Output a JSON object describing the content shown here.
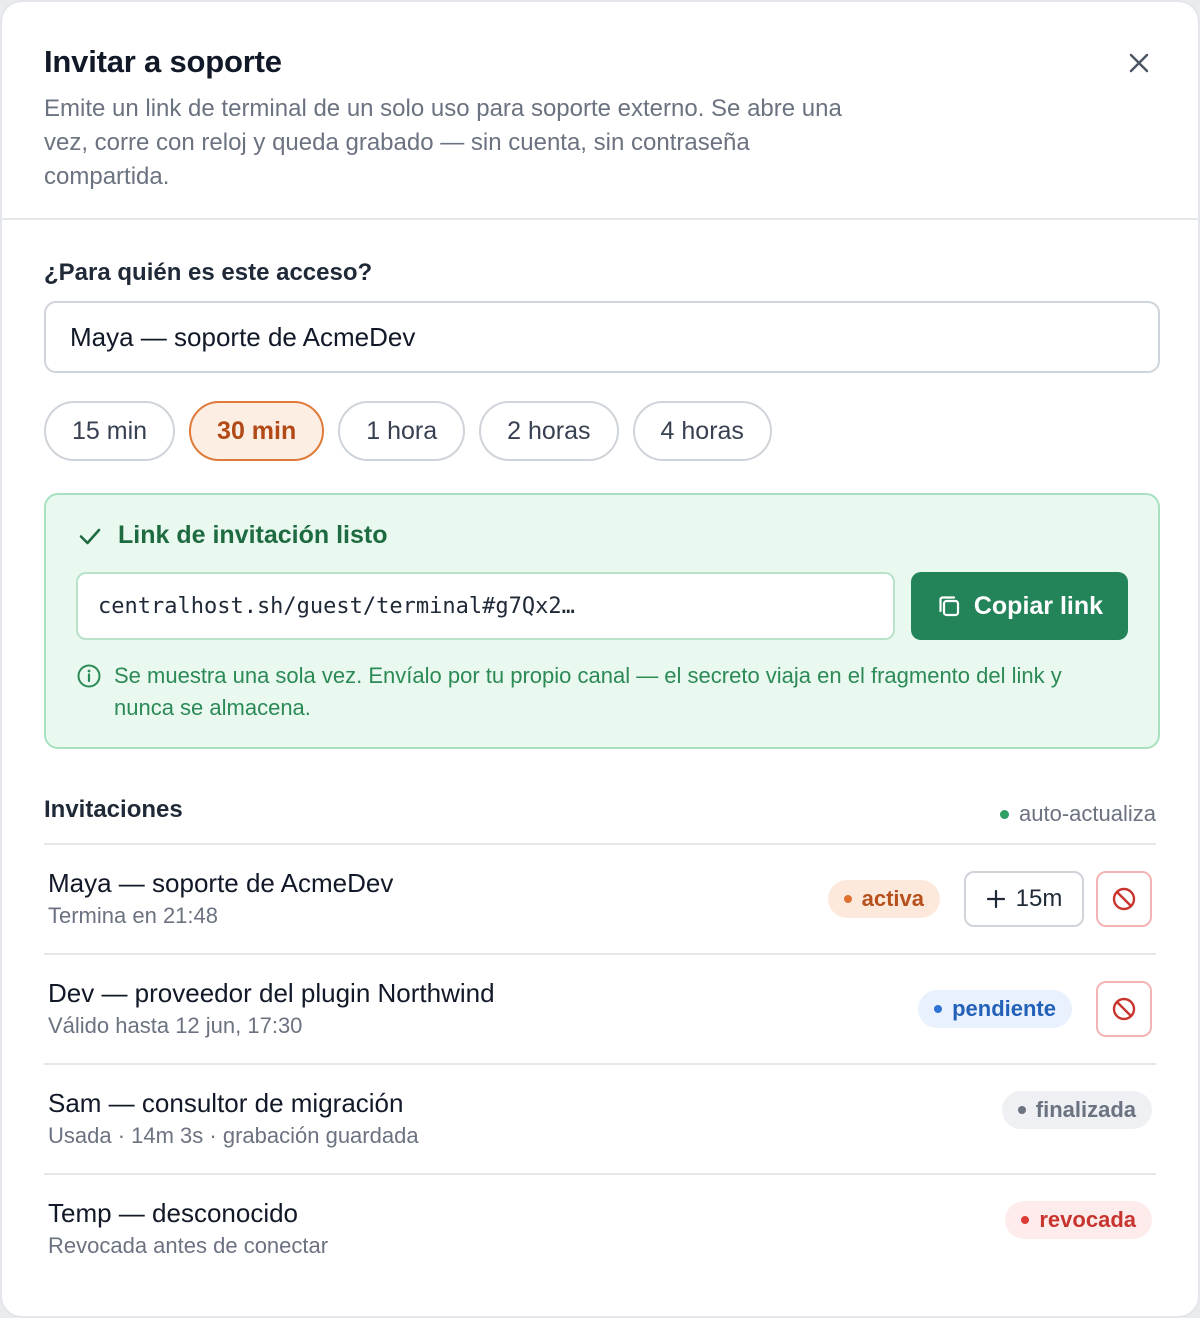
{
  "dialog": {
    "title": "Invitar a soporte",
    "subtitle": "Emite un link de terminal de un solo uso para soporte externo. Se abre una vez, corre con reloj y queda grabado — sin cuenta, sin contraseña compartida."
  },
  "form": {
    "recipient_label": "¿Para quién es este acceso?",
    "recipient_value": "Maya — soporte de AcmeDev",
    "durations": [
      "15 min",
      "30 min",
      "1 hora",
      "2 horas",
      "4 horas"
    ],
    "selected_duration": "30 min"
  },
  "ready": {
    "title": "Link de invitación listo",
    "link": "centralhost.sh/guest/terminal#g7Qx2…",
    "copy_label": "Copiar link",
    "note": "Se muestra una sola vez. Envíalo por tu propio canal — el secreto viaja en el fragmento del link y nunca se almacena."
  },
  "invitations": {
    "title": "Invitaciones",
    "auto_refresh": "auto-actualiza",
    "items": [
      {
        "name": "Maya — soporte de AcmeDev",
        "detail": "Termina en 21:48",
        "status": "activa",
        "extend_label": "15m"
      },
      {
        "name": "Dev — proveedor del plugin Northwind",
        "detail": "Válido hasta 12 jun, 17:30",
        "status": "pendiente"
      },
      {
        "name": "Sam — consultor de migración",
        "detail": "Usada · 14m 3s · grabación guardada",
        "status": "finalizada"
      },
      {
        "name": "Temp — desconocido",
        "detail": "Revocada antes de conectar",
        "status": "revocada"
      }
    ]
  },
  "colors": {
    "accent_orange": "#e07a3a",
    "success_green": "#23845a",
    "pending_blue": "#2f72d6",
    "revoked_red": "#dc3b35"
  },
  "icons": {
    "close": "close-icon",
    "check": "check-icon",
    "copy": "copy-icon",
    "info": "info-icon",
    "plus": "plus-icon",
    "revoke": "ban-icon"
  }
}
